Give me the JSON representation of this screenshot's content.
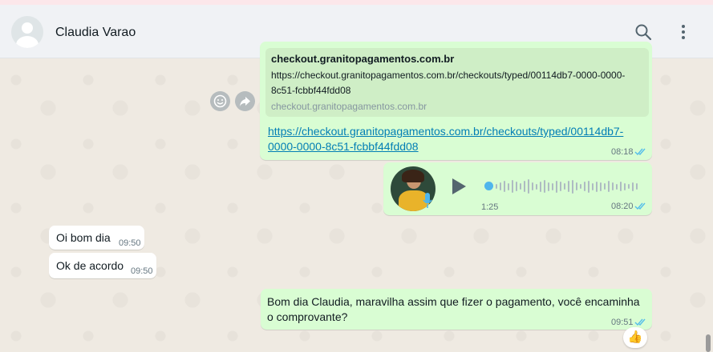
{
  "contact": {
    "name": "Claudia Varao"
  },
  "header": {
    "search_icon": "search-icon",
    "menu_icon": "kebab-menu-icon"
  },
  "messages": {
    "link_preview": {
      "title": "checkout.granitopagamentos.com.br",
      "description": "https://checkout.granitopagamentos.com.br/checkouts/typed/00114db7-0000-0000-8c51-fcbbf44fdd08",
      "domain": "checkout.granitopagamentos.com.br",
      "link_text": "https://checkout.granitopagamentos.com.br/checkouts/typed/00114db7-0000-0000-8c51-fcbbf44fdd08",
      "time": "08:18"
    },
    "voice_note": {
      "duration": "1:25",
      "time": "08:20",
      "progress": 0
    },
    "incoming": [
      {
        "text": "Oi bom dia",
        "time": "09:50"
      },
      {
        "text": "Ok de acordo",
        "time": "09:50"
      }
    ],
    "outgoing_last": {
      "text": "Bom dia Claudia, maravilha assim que fizer o pagamento, você encaminha o comprovante?",
      "time": "09:51",
      "reaction": "👍"
    }
  },
  "colors": {
    "outgoing": "#d9fdd3",
    "incoming": "#ffffff",
    "tick_read": "#53bdeb",
    "link": "#027eb5"
  }
}
